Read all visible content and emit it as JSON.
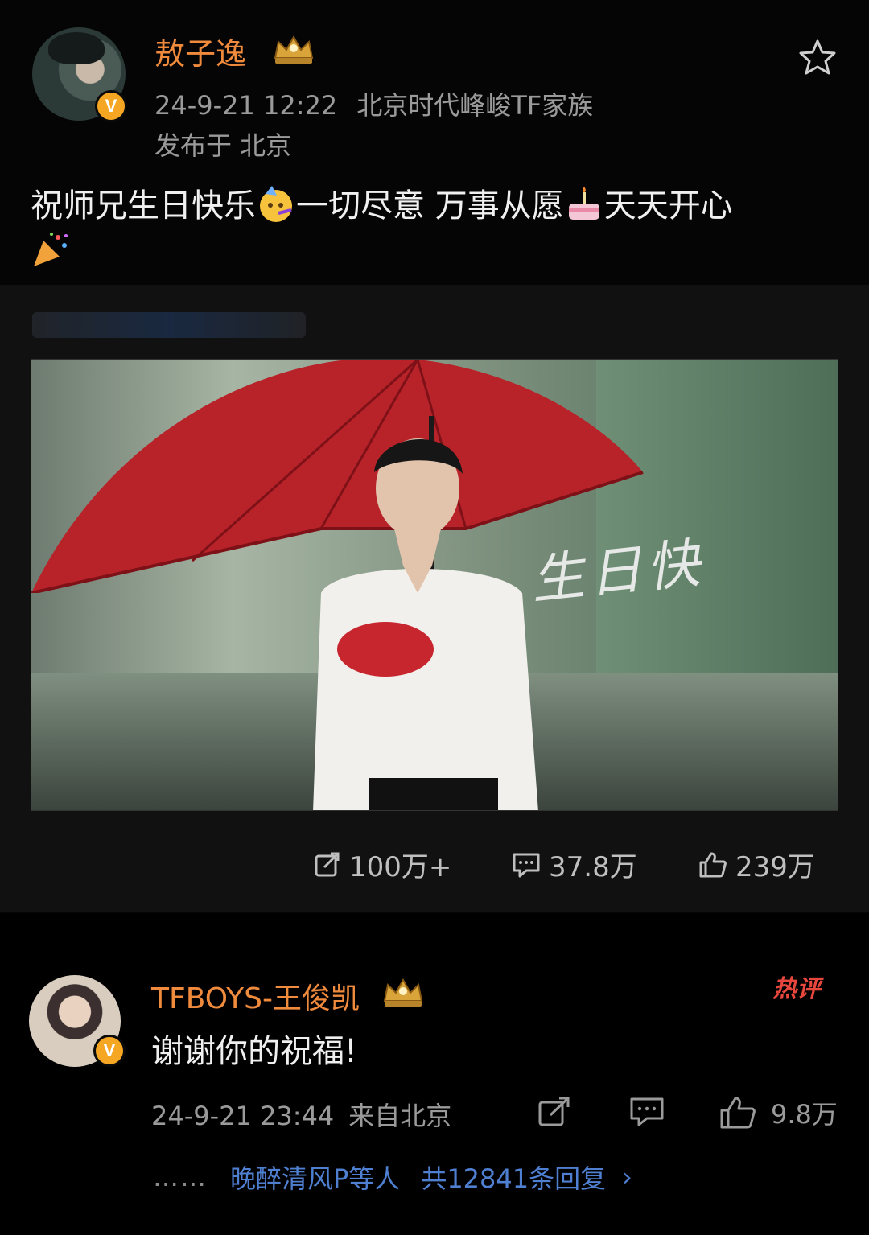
{
  "post": {
    "author": "敖子逸",
    "timestamp": "24-9-21 12:22",
    "source": "北京时代峰峻TF家族",
    "location": "发布于 北京",
    "text_part1": "祝师兄生日快乐",
    "text_part2": "一切尽意 万事从愿",
    "text_part3": "天天开心",
    "emojis": [
      "party-face-emoji",
      "birthday-cake-emoji",
      "party-popper-emoji"
    ],
    "verified_badge": "V",
    "image_caption": "生日快",
    "stats": {
      "reposts": "100万+",
      "comments": "37.8万",
      "likes": "239万"
    }
  },
  "comment": {
    "author": "TFBOYS-王俊凯",
    "hot_label": "热评",
    "verified_badge": "V",
    "text": "谢谢你的祝福!",
    "timestamp": "24-9-21 23:44",
    "source": "来自北京",
    "likes": "9.8万",
    "replies_prefix": "……",
    "replies_who": "晚醉清风P等人",
    "replies_count": "共12841条回复"
  },
  "colors": {
    "background": "#000000",
    "username": "#f08a3c",
    "meta": "#9a9a9a",
    "link": "#4f7fd0",
    "hot": "#e8473d",
    "badge": "#f5a623"
  }
}
